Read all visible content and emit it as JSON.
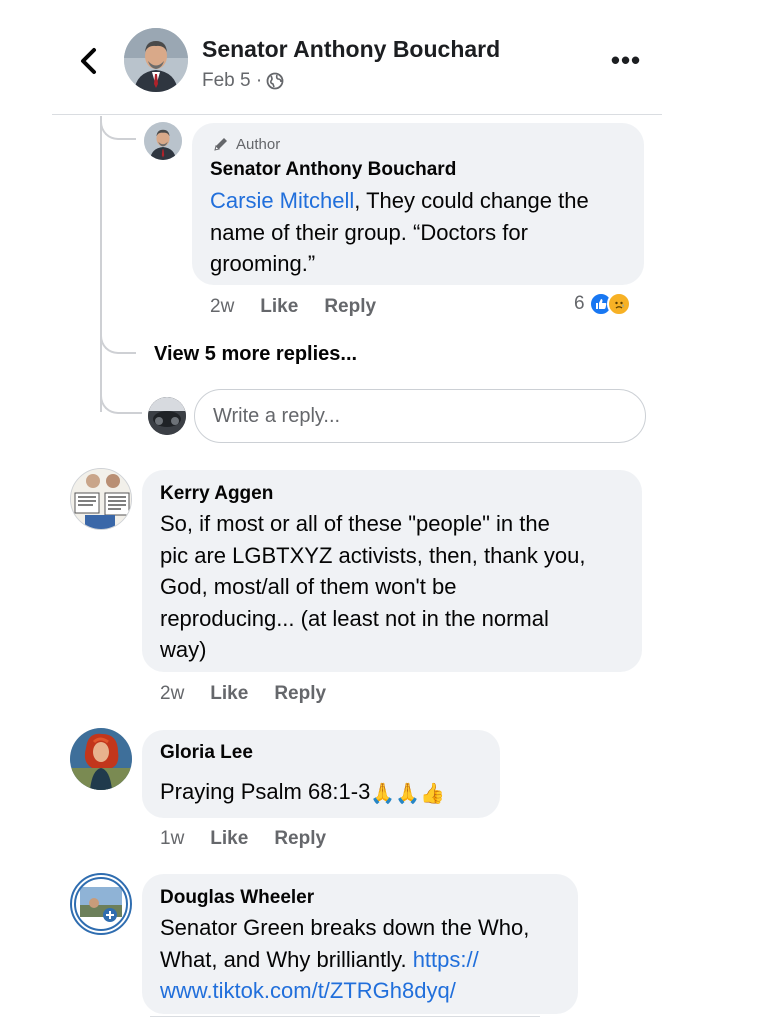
{
  "header": {
    "back_icon": "chevron-left-icon",
    "name": "Senator Anthony Bouchard",
    "date": "Feb 5 ·",
    "privacy_icon": "globe-icon",
    "more_label": "•••"
  },
  "author_reply": {
    "badge": "Author",
    "badge_icon": "pencil-icon",
    "name": "Senator Anthony Bouchard",
    "mention": "Carsie Mitchell",
    "text_line1_rest": ", They could change the",
    "text_line2": "name of their group. “Doctors for",
    "text_line3": "grooming.”",
    "time": "2w",
    "like": "Like",
    "reply": "Reply",
    "reaction_count": "6",
    "reaction_icons": [
      "like-reaction-icon",
      "sad-reaction-icon"
    ]
  },
  "view_more": "View 5 more replies...",
  "reply_input": {
    "placeholder": "Write a reply..."
  },
  "comments": [
    {
      "name": "Kerry Aggen",
      "lines": [
        "So, if most or all of these \"people\" in the",
        "pic are LGBTXYZ activists, then, thank you,",
        "God, most/all of them won't be",
        "reproducing... (at least not in the normal",
        "way)"
      ],
      "time": "2w",
      "like": "Like",
      "reply": "Reply"
    },
    {
      "name": "Gloria Lee",
      "text": "Praying Psalm 68:1-3",
      "emojis": "🙏🙏👍",
      "time": "1w",
      "like": "Like",
      "reply": "Reply"
    },
    {
      "name": "Douglas Wheeler",
      "line1": "Senator Green breaks down the Who,",
      "line2": "What, and Why brilliantly. ",
      "link1": "https://",
      "link2": "www.tiktok.com/t/ZTRGh8dyq/"
    }
  ],
  "colors": {
    "bubble": "#f0f2f5",
    "link": "#216fdb",
    "secondary_text": "#65676b",
    "like_blue": "#1877f2"
  }
}
